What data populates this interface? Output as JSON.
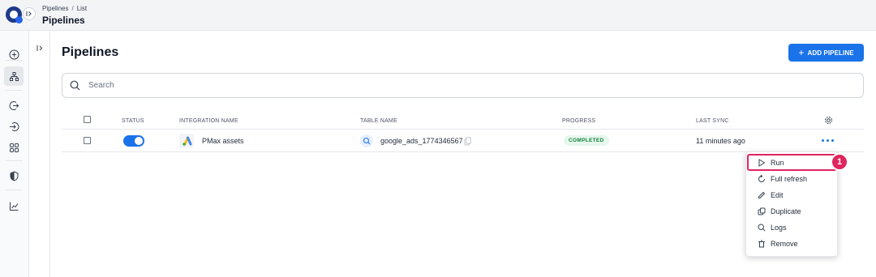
{
  "header": {
    "breadcrumb": [
      "Pipelines",
      "List"
    ],
    "breadcrumb_sep": "/",
    "title": "Pipelines"
  },
  "rail": {
    "items": [
      "add-circle-icon",
      "pipelines-icon",
      "import-icon",
      "export-icon",
      "grid-icon",
      "shield-icon",
      "chart-icon"
    ],
    "active": "pipelines-icon"
  },
  "page": {
    "title": "Pipelines",
    "add_button_label": "ADD PIPELINE"
  },
  "search": {
    "placeholder": "Search",
    "value": ""
  },
  "table": {
    "columns": [
      "STATUS",
      "INTEGRATION NAME",
      "TABLE NAME",
      "PROGRESS",
      "LAST SYNC"
    ],
    "rows": [
      {
        "status_on": true,
        "integration_name": "PMax assets",
        "table_name": "google_ads_1774346567",
        "progress": "COMPLETED",
        "last_sync": "11 minutes ago"
      }
    ]
  },
  "context_menu": {
    "items": [
      {
        "label": "Run",
        "icon": "play-icon"
      },
      {
        "label": "Full refresh",
        "icon": "refresh-icon"
      },
      {
        "label": "Edit",
        "icon": "pencil-icon"
      },
      {
        "label": "Duplicate",
        "icon": "duplicate-icon"
      },
      {
        "label": "Logs",
        "icon": "search-icon"
      },
      {
        "label": "Remove",
        "icon": "trash-icon"
      }
    ],
    "highlighted": "Run"
  },
  "annotation": {
    "step": "1"
  },
  "colors": {
    "accent": "#1a73e8",
    "success_text": "#15803d",
    "success_bg": "#e6f7ec",
    "annotation": "#e0245e"
  }
}
